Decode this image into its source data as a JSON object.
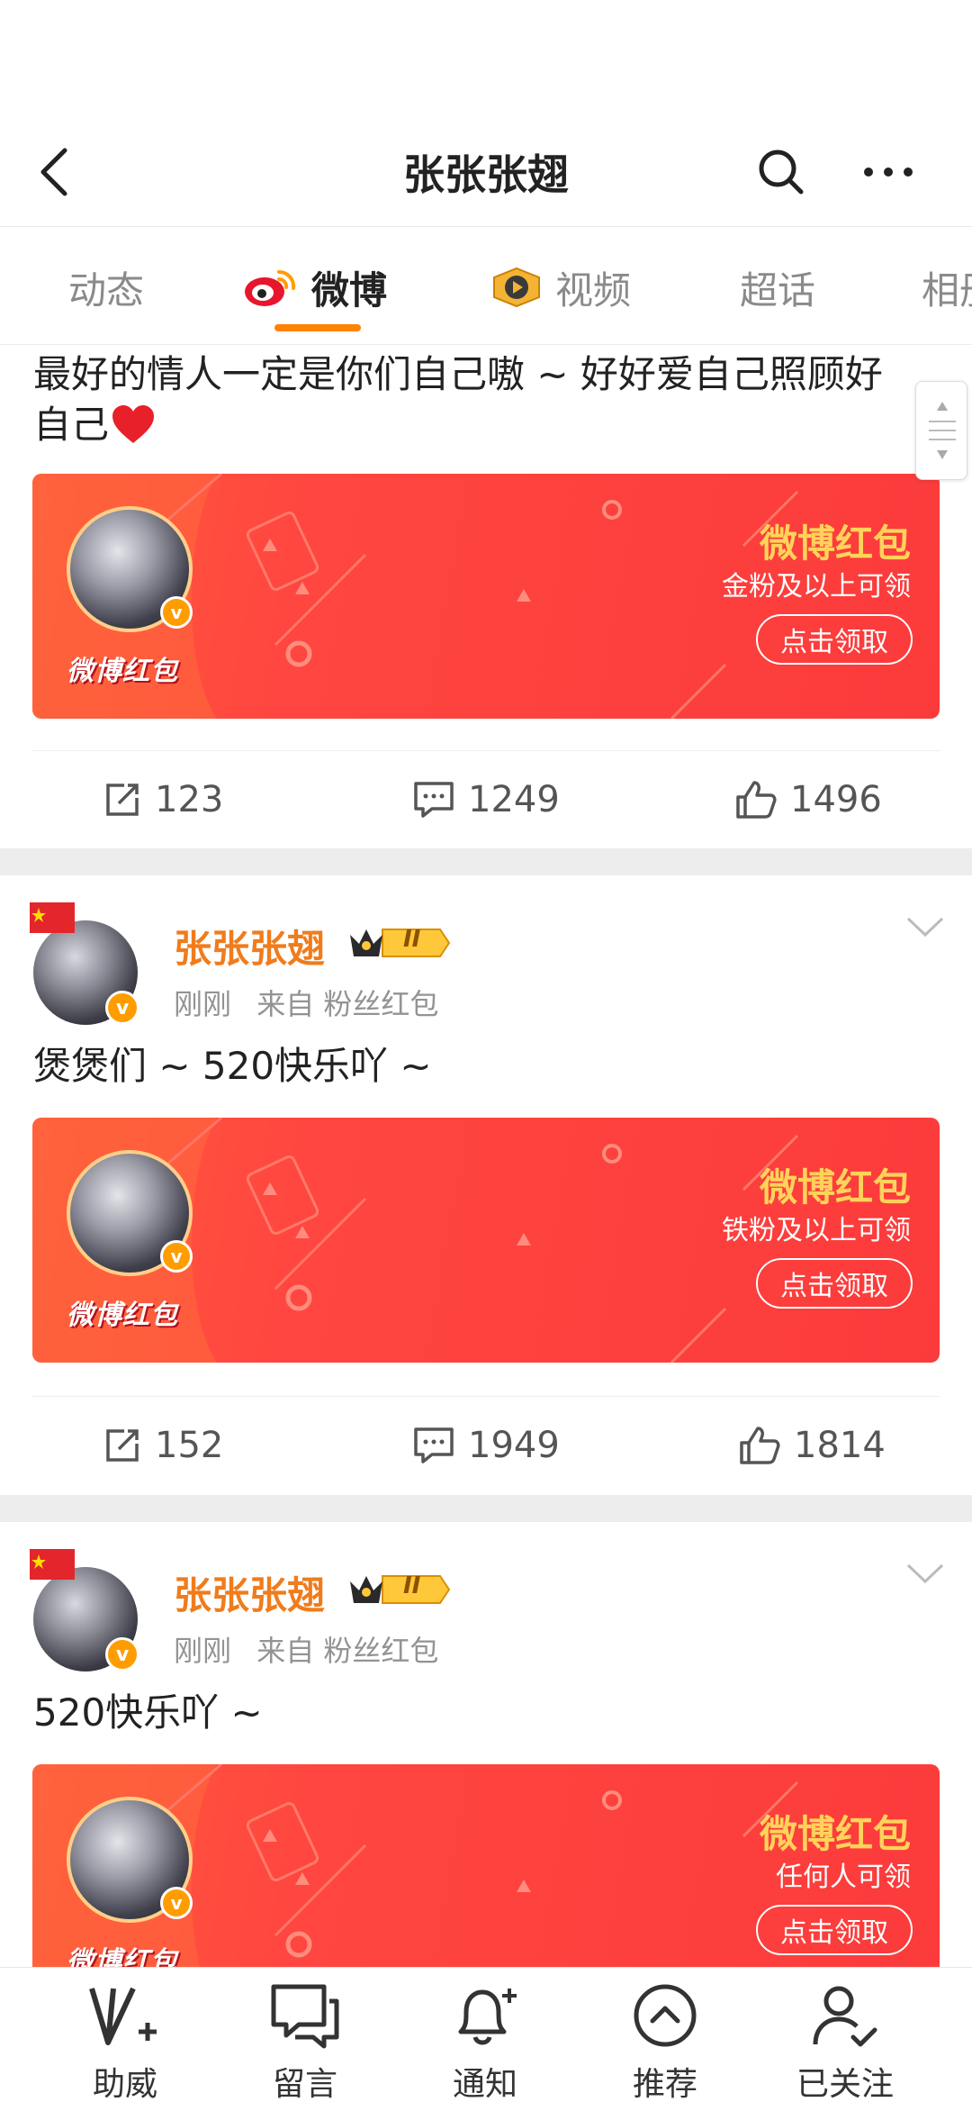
{
  "header": {
    "title": "张张张翅"
  },
  "tabs": [
    {
      "label": "动态"
    },
    {
      "label": "微博"
    },
    {
      "label": "视频"
    },
    {
      "label": "超话"
    },
    {
      "label": "相册"
    }
  ],
  "posts": [
    {
      "text_line1": "最好的情人一定是你们自己嗷 ~ 好好爱自己照顾好",
      "text_line2": "自己",
      "card": {
        "logo": "微博红包",
        "title": "微博红包",
        "subtitle": "金粉及以上可领",
        "button": "点击领取"
      },
      "reposts": "123",
      "comments": "1249",
      "likes": "1496"
    },
    {
      "username": "张张张翅",
      "vip_level": "II",
      "time": "刚刚",
      "source": "来自 粉丝红包",
      "text": "煲煲们 ~ 520快乐吖 ~",
      "card": {
        "logo": "微博红包",
        "title": "微博红包",
        "subtitle": "铁粉及以上可领",
        "button": "点击领取"
      },
      "reposts": "152",
      "comments": "1949",
      "likes": "1814"
    },
    {
      "username": "张张张翅",
      "vip_level": "II",
      "time": "刚刚",
      "source": "来自 粉丝红包",
      "text": "520快乐吖 ~",
      "card": {
        "logo": "微博红包",
        "title": "微博红包",
        "subtitle": "任何人可领",
        "button": "点击领取"
      }
    }
  ],
  "bottom_nav": [
    {
      "label": "助威"
    },
    {
      "label": "留言"
    },
    {
      "label": "通知"
    },
    {
      "label": "推荐"
    },
    {
      "label": "已关注"
    }
  ],
  "colors": {
    "accent_orange": "#ff8200",
    "username_orange": "#f07c1c",
    "card_red": "#fb3b3b",
    "card_title_gold": "#ffd35a"
  }
}
